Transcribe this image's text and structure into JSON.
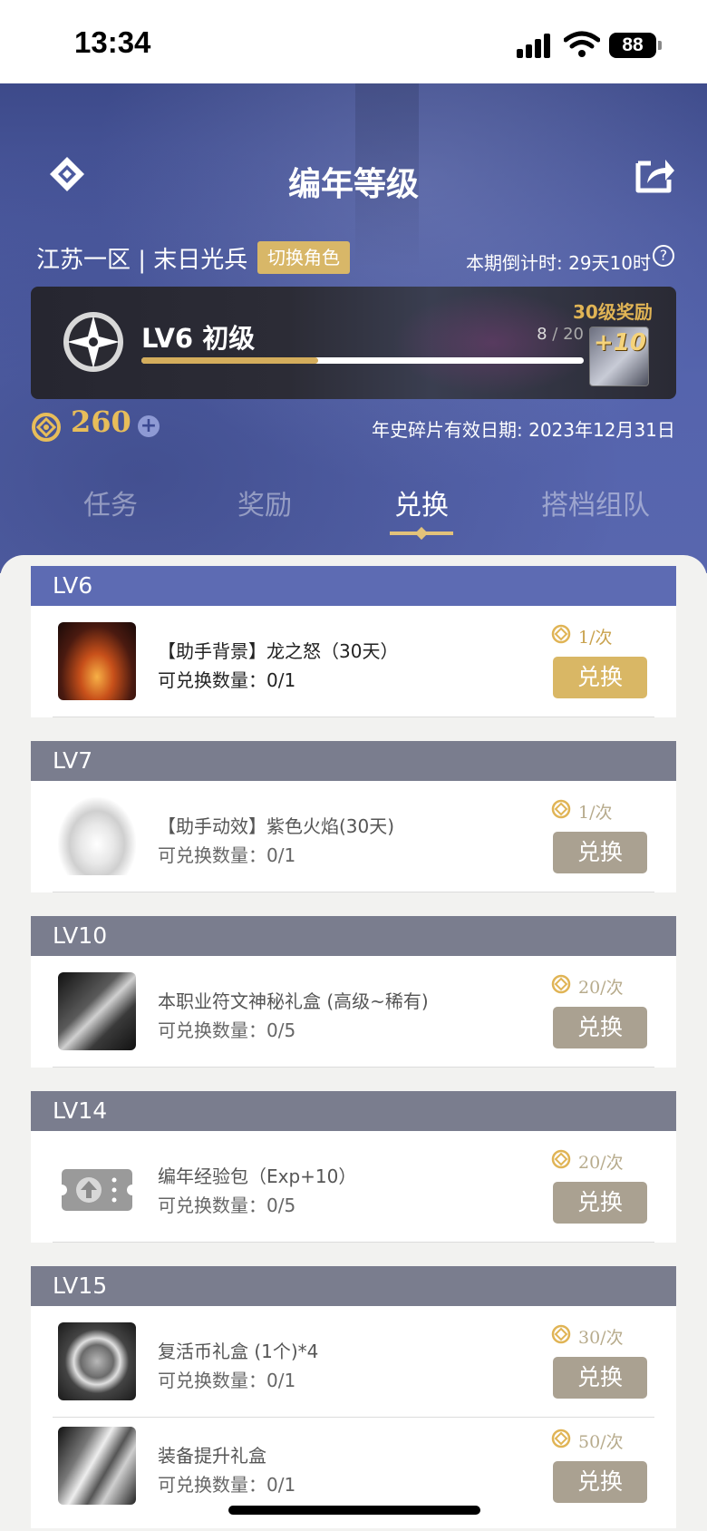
{
  "status_bar": {
    "time": "13:34",
    "battery": "88"
  },
  "header": {
    "title": "编年等级"
  },
  "profile": {
    "server_role": "江苏一区 | 末日光兵",
    "switch_label": "切换角色",
    "countdown": "本期倒计时: 29天10时",
    "help": "?"
  },
  "level": {
    "label": "LV6 初级",
    "progress_current": "8",
    "progress_sep": " / ",
    "progress_total": "20",
    "progress_fraction": 0.4,
    "reward_label": "30级奖励",
    "reward_badge": "+10"
  },
  "currency": {
    "amount": "260",
    "plus": "+",
    "expire": "年史碎片有效日期: 2023年12月31日"
  },
  "tabs": [
    {
      "label": "任务"
    },
    {
      "label": "奖励"
    },
    {
      "label": "兑换",
      "active": true
    },
    {
      "label": "搭档组队"
    }
  ],
  "groups": [
    {
      "level": "LV6",
      "active": true,
      "items": [
        {
          "name": "【助手背景】龙之怒（30天）",
          "qty": "可兑换数量：0/1",
          "cost": "1/次",
          "button": "兑换",
          "icon": "dragon-fire-icon"
        }
      ]
    },
    {
      "level": "LV7",
      "active": false,
      "items": [
        {
          "name": "【助手动效】紫色火焰(30天)",
          "qty": "可兑换数量：0/1",
          "cost": "1/次",
          "button": "兑换",
          "icon": "white-flame-icon"
        }
      ]
    },
    {
      "level": "LV10",
      "active": false,
      "items": [
        {
          "name": "本职业符文神秘礼盒 (高级~稀有)",
          "qty": "可兑换数量：0/5",
          "cost": "20/次",
          "button": "兑换",
          "icon": "rune-box-icon"
        }
      ]
    },
    {
      "level": "LV14",
      "active": false,
      "items": [
        {
          "name": "编年经验包（Exp+10）",
          "qty": "可兑换数量：0/5",
          "cost": "20/次",
          "button": "兑换",
          "icon": "exp-ticket-icon"
        }
      ]
    },
    {
      "level": "LV15",
      "active": false,
      "items": [
        {
          "name": "复活币礼盒 (1个)*4",
          "qty": "可兑换数量：0/1",
          "cost": "30/次",
          "button": "兑换",
          "icon": "revive-coin-icon"
        },
        {
          "name": "装备提升礼盒",
          "qty": "可兑换数量：0/1",
          "cost": "50/次",
          "button": "兑换",
          "icon": "gear-upgrade-icon"
        }
      ]
    }
  ],
  "colors": {
    "accent_gold": "#d9b765",
    "header_active": "#5d6bb3",
    "header_inactive": "#7a7d8e",
    "hero_blue": "#4c5aa0"
  }
}
